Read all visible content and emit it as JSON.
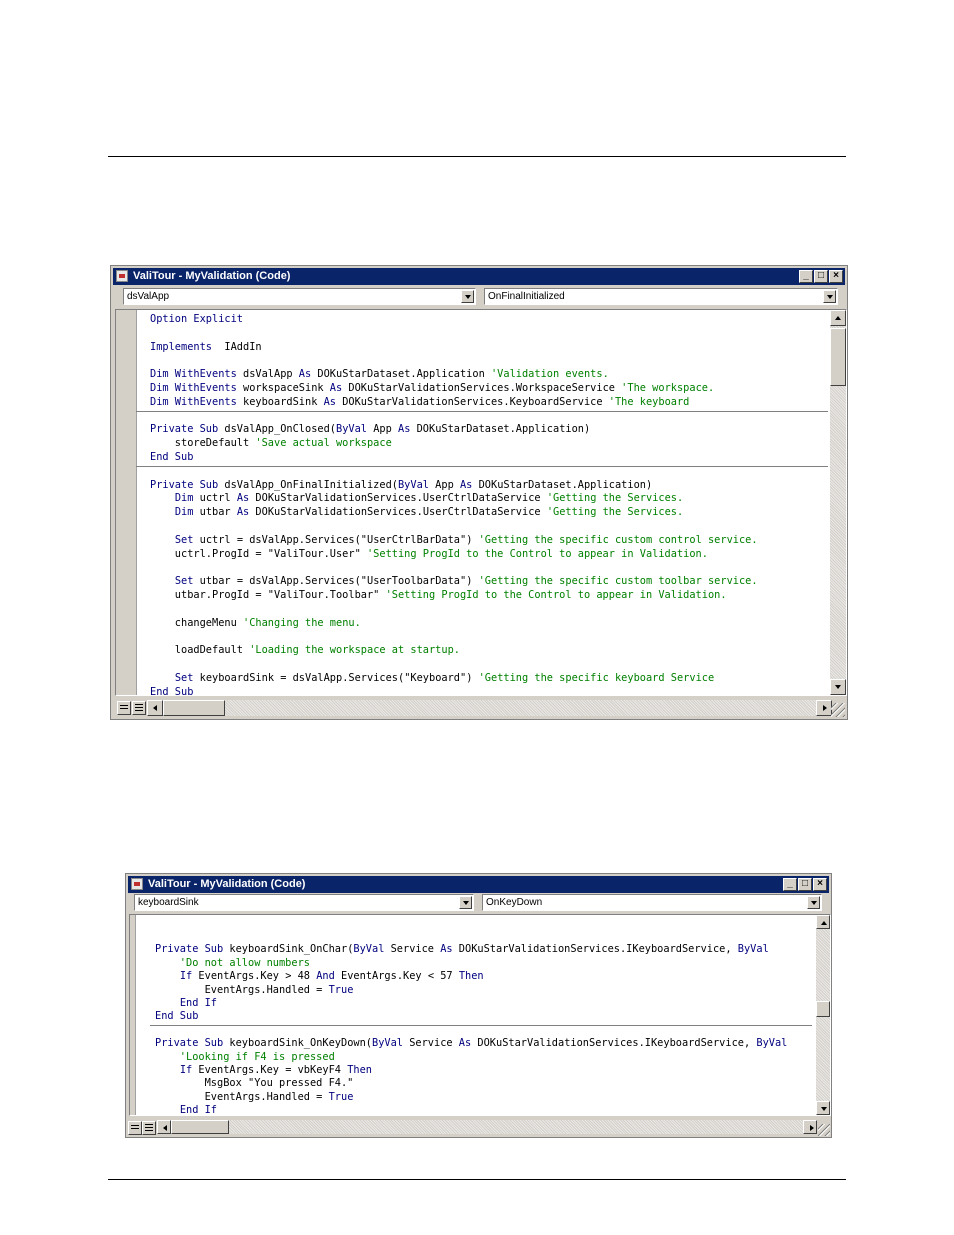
{
  "window1": {
    "title": "ValiTour - MyValidation (Code)",
    "object_combo": "dsValApp",
    "procedure_combo": "OnFinalInitialized",
    "lines": [
      [
        [
          "kw",
          "Option Explicit"
        ]
      ],
      [],
      [
        [
          "kw",
          "Implements"
        ],
        [
          "",
          "  IAddIn"
        ]
      ],
      [],
      [
        [
          "kw",
          "Dim WithEvents"
        ],
        [
          "",
          " dsValApp "
        ],
        [
          "kw",
          "As"
        ],
        [
          "",
          " DOKuStarDataset.Application "
        ],
        [
          "cm",
          "'Validation events."
        ]
      ],
      [
        [
          "kw",
          "Dim WithEvents"
        ],
        [
          "",
          " workspaceSink "
        ],
        [
          "kw",
          "As"
        ],
        [
          "",
          " DOKuStarValidationServices.WorkspaceService "
        ],
        [
          "cm",
          "'The workspace."
        ]
      ],
      [
        [
          "kw",
          "Dim WithEvents"
        ],
        [
          "",
          " keyboardSink "
        ],
        [
          "kw",
          "As"
        ],
        [
          "",
          " DOKuStarValidationServices.KeyboardService "
        ],
        [
          "cm",
          "'The keyboard"
        ]
      ],
      [],
      [
        [
          "kw",
          "Private Sub"
        ],
        [
          "",
          " dsValApp_OnClosed("
        ],
        [
          "kw",
          "ByVal"
        ],
        [
          "",
          " App "
        ],
        [
          "kw",
          "As"
        ],
        [
          "",
          " DOKuStarDataset.Application)"
        ]
      ],
      [
        [
          "",
          "    storeDefault "
        ],
        [
          "cm",
          "'Save actual workspace"
        ]
      ],
      [
        [
          "kw",
          "End Sub"
        ]
      ],
      [],
      [
        [
          "kw",
          "Private Sub"
        ],
        [
          "",
          " dsValApp_OnFinalInitialized("
        ],
        [
          "kw",
          "ByVal"
        ],
        [
          "",
          " App "
        ],
        [
          "kw",
          "As"
        ],
        [
          "",
          " DOKuStarDataset.Application)"
        ]
      ],
      [
        [
          "",
          "    "
        ],
        [
          "kw",
          "Dim"
        ],
        [
          "",
          " uctrl "
        ],
        [
          "kw",
          "As"
        ],
        [
          "",
          " DOKuStarValidationServices.UserCtrlDataService "
        ],
        [
          "cm",
          "'Getting the Services."
        ]
      ],
      [
        [
          "",
          "    "
        ],
        [
          "kw",
          "Dim"
        ],
        [
          "",
          " utbar "
        ],
        [
          "kw",
          "As"
        ],
        [
          "",
          " DOKuStarValidationServices.UserCtrlDataService "
        ],
        [
          "cm",
          "'Getting the Services."
        ]
      ],
      [],
      [
        [
          "",
          "    "
        ],
        [
          "kw",
          "Set"
        ],
        [
          "",
          " uctrl = dsValApp.Services(\"UserCtrlBarData\") "
        ],
        [
          "cm",
          "'Getting the specific custom control service."
        ]
      ],
      [
        [
          "",
          "    uctrl.ProgId = \"ValiTour.User\" "
        ],
        [
          "cm",
          "'Setting ProgId to the Control to appear in Validation."
        ]
      ],
      [],
      [
        [
          "",
          "    "
        ],
        [
          "kw",
          "Set"
        ],
        [
          "",
          " utbar = dsValApp.Services(\"UserToolbarData\") "
        ],
        [
          "cm",
          "'Getting the specific custom toolbar service."
        ]
      ],
      [
        [
          "",
          "    utbar.ProgId = \"ValiTour.Toolbar\" "
        ],
        [
          "cm",
          "'Setting ProgId to the Control to appear in Validation."
        ]
      ],
      [],
      [
        [
          "",
          "    changeMenu "
        ],
        [
          "cm",
          "'Changing the menu."
        ]
      ],
      [],
      [
        [
          "",
          "    loadDefault "
        ],
        [
          "cm",
          "'Loading the workspace at startup."
        ]
      ],
      [],
      [
        [
          "",
          "    "
        ],
        [
          "kw",
          "Set"
        ],
        [
          "",
          " keyboardSink = dsValApp.Services(\"Keyboard\") "
        ],
        [
          "cm",
          "'Getting the specific keyboard Service"
        ]
      ],
      [
        [
          "kw",
          "End Sub"
        ]
      ]
    ]
  },
  "window2": {
    "title": "ValiTour - MyValidation (Code)",
    "object_combo": "keyboardSink",
    "procedure_combo": "OnKeyDown",
    "lines": [
      [],
      [
        [
          "kw",
          "Private Sub"
        ],
        [
          "",
          " keyboardSink_OnChar("
        ],
        [
          "kw",
          "ByVal"
        ],
        [
          "",
          " Service "
        ],
        [
          "kw",
          "As"
        ],
        [
          "",
          " DOKuStarValidationServices.IKeyboardService, "
        ],
        [
          "kw",
          "ByVal"
        ]
      ],
      [
        [
          "cm",
          "    'Do not allow numbers"
        ]
      ],
      [
        [
          "",
          "    "
        ],
        [
          "kw",
          "If"
        ],
        [
          "",
          " EventArgs.Key > 48 "
        ],
        [
          "kw",
          "And"
        ],
        [
          "",
          " EventArgs.Key < 57 "
        ],
        [
          "kw",
          "Then"
        ]
      ],
      [
        [
          "",
          "        EventArgs.Handled = "
        ],
        [
          "kw",
          "True"
        ]
      ],
      [
        [
          "",
          "    "
        ],
        [
          "kw",
          "End If"
        ]
      ],
      [
        [
          "kw",
          "End Sub"
        ]
      ],
      [],
      [
        [
          "kw",
          "Private Sub"
        ],
        [
          "",
          " keyboardSink_OnKeyDown("
        ],
        [
          "kw",
          "ByVal"
        ],
        [
          "",
          " Service "
        ],
        [
          "kw",
          "As"
        ],
        [
          "",
          " DOKuStarValidationServices.IKeyboardService, "
        ],
        [
          "kw",
          "ByVal"
        ]
      ],
      [
        [
          "cm",
          "    'Looking if F4 is pressed"
        ]
      ],
      [
        [
          "",
          "    "
        ],
        [
          "kw",
          "If"
        ],
        [
          "",
          " EventArgs.Key = vbKeyF4 "
        ],
        [
          "kw",
          "Then"
        ]
      ],
      [
        [
          "",
          "        MsgBox \"You pressed F4.\""
        ]
      ],
      [
        [
          "",
          "        EventArgs.Handled = "
        ],
        [
          "kw",
          "True"
        ]
      ],
      [
        [
          "",
          "    "
        ],
        [
          "kw",
          "End If"
        ]
      ],
      [
        [
          "kw",
          "End Sub"
        ]
      ]
    ]
  }
}
